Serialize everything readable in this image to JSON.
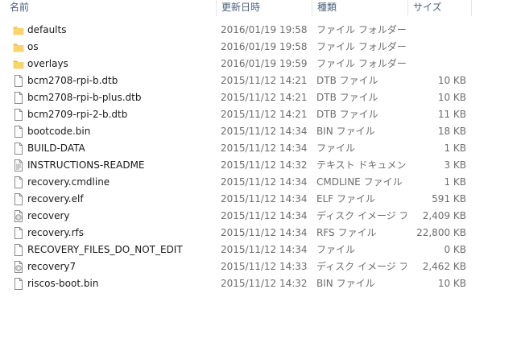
{
  "columns": {
    "name": "名前",
    "date": "更新日時",
    "type": "種類",
    "size": "サイズ"
  },
  "colors": {
    "folder": "#f8d46c",
    "folder_dark": "#e7b941",
    "header_text": "#4c607a",
    "detail_text": "#6d6d6d"
  },
  "files": [
    {
      "name": "defaults",
      "date": "2016/01/19 19:58",
      "type": "ファイル フォルダー",
      "size": "",
      "icon": "folder-icon"
    },
    {
      "name": "os",
      "date": "2016/01/19 19:58",
      "type": "ファイル フォルダー",
      "size": "",
      "icon": "folder-icon"
    },
    {
      "name": "overlays",
      "date": "2016/01/19 19:59",
      "type": "ファイル フォルダー",
      "size": "",
      "icon": "folder-icon"
    },
    {
      "name": "bcm2708-rpi-b.dtb",
      "date": "2015/11/12 14:21",
      "type": "DTB ファイル",
      "size": "10 KB",
      "icon": "file-icon"
    },
    {
      "name": "bcm2708-rpi-b-plus.dtb",
      "date": "2015/11/12 14:21",
      "type": "DTB ファイル",
      "size": "10 KB",
      "icon": "file-icon"
    },
    {
      "name": "bcm2709-rpi-2-b.dtb",
      "date": "2015/11/12 14:21",
      "type": "DTB ファイル",
      "size": "11 KB",
      "icon": "file-icon"
    },
    {
      "name": "bootcode.bin",
      "date": "2015/11/12 14:34",
      "type": "BIN ファイル",
      "size": "18 KB",
      "icon": "file-icon"
    },
    {
      "name": "BUILD-DATA",
      "date": "2015/11/12 14:34",
      "type": "ファイル",
      "size": "1 KB",
      "icon": "file-icon"
    },
    {
      "name": "INSTRUCTIONS-README",
      "date": "2015/11/12 14:32",
      "type": "テキスト ドキュメント",
      "size": "3 KB",
      "icon": "text-document-icon"
    },
    {
      "name": "recovery.cmdline",
      "date": "2015/11/12 14:34",
      "type": "CMDLINE ファイル",
      "size": "1 KB",
      "icon": "file-icon"
    },
    {
      "name": "recovery.elf",
      "date": "2015/11/12 14:34",
      "type": "ELF ファイル",
      "size": "591 KB",
      "icon": "file-icon"
    },
    {
      "name": "recovery",
      "date": "2015/11/12 14:34",
      "type": "ディスク イメージ ファイル",
      "size": "2,409 KB",
      "icon": "disc-image-icon"
    },
    {
      "name": "recovery.rfs",
      "date": "2015/11/12 14:34",
      "type": "RFS ファイル",
      "size": "22,800 KB",
      "icon": "file-icon"
    },
    {
      "name": "RECOVERY_FILES_DO_NOT_EDIT",
      "date": "2015/11/12 14:34",
      "type": "ファイル",
      "size": "0 KB",
      "icon": "file-icon"
    },
    {
      "name": "recovery7",
      "date": "2015/11/12 14:33",
      "type": "ディスク イメージ ファイル",
      "size": "2,462 KB",
      "icon": "disc-image-icon"
    },
    {
      "name": "riscos-boot.bin",
      "date": "2015/11/12 14:32",
      "type": "BIN ファイル",
      "size": "10 KB",
      "icon": "file-icon"
    }
  ]
}
